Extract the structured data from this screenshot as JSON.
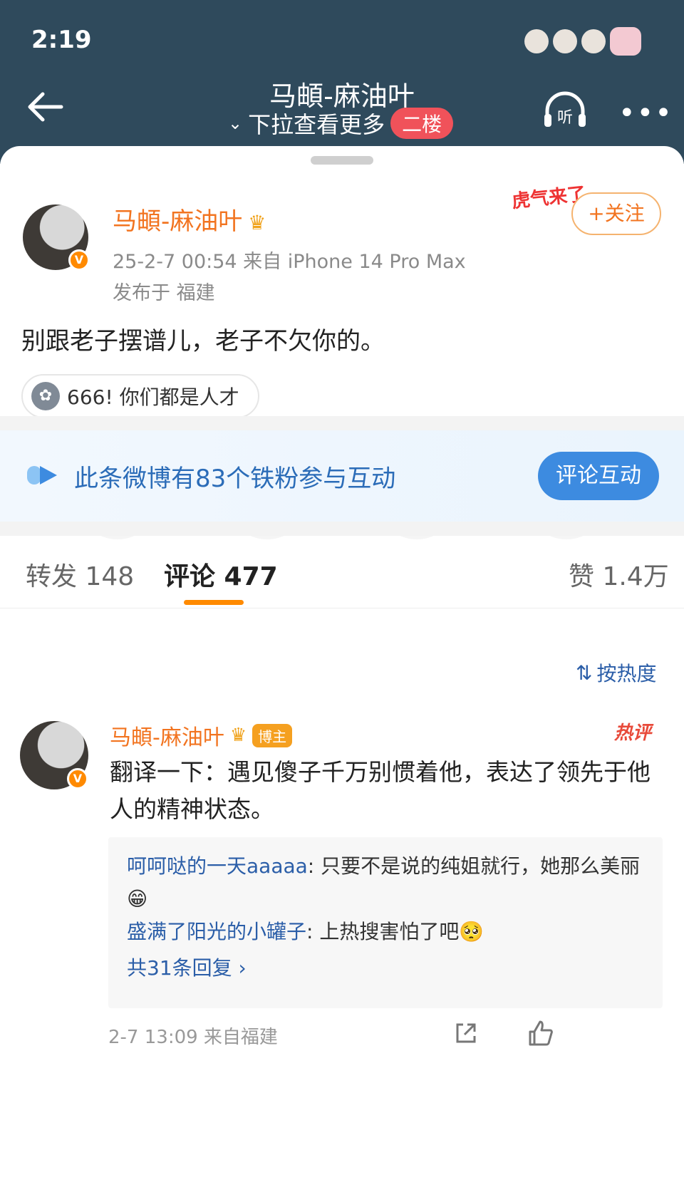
{
  "status_bar": {
    "time": "2:19"
  },
  "header": {
    "title": "马頔-麻油叶",
    "subtitle": "下拉查看更多",
    "floor_badge": "二楼",
    "listen_label": "听",
    "more_label": "•••"
  },
  "post": {
    "author": "马頔-麻油叶",
    "meta": "25-2-7 00:54  来自 iPhone 14 Pro Max",
    "location": "发布于 福建",
    "festival_badge": "虎气来了",
    "follow_label": "+关注",
    "text": "别跟老子摆谱儿，老子不欠你的。",
    "chip_text": "666!  你们都是人才"
  },
  "share_targets": [
    "wechat-icon",
    "moments-icon",
    "qq-icon",
    "save-image-icon"
  ],
  "fans_bar": {
    "text": "此条微博有83个铁粉参与互动",
    "button": "评论互动"
  },
  "tabs": {
    "repost": "转发 148",
    "comments": "评论 477",
    "likes": "赞 1.4万"
  },
  "sort_label": "按热度",
  "comment": {
    "author": "马頔-麻油叶",
    "op_badge": "博主",
    "hot_badge": "热评",
    "text": "翻译一下：遇见傻子千万别惯着他，表达了领先于他人的精神状态。",
    "replies": [
      {
        "who": "呵呵哒的一天aaaaa",
        "text": ": 只要不是说的纯姐就行，她那么美丽😁"
      },
      {
        "who": "盛满了阳光的小罐子",
        "text": ": 上热搜害怕了吧🥺"
      }
    ],
    "more_replies": "共31条回复 ›",
    "footer": "2-7 13:09  来自福建"
  },
  "colors": {
    "header_bg": "#2f4a5c",
    "accent_orange": "#f27420",
    "link_blue": "#2b5ea8",
    "fans_button": "#3d8be0",
    "floor_badge": "#f0525a"
  }
}
